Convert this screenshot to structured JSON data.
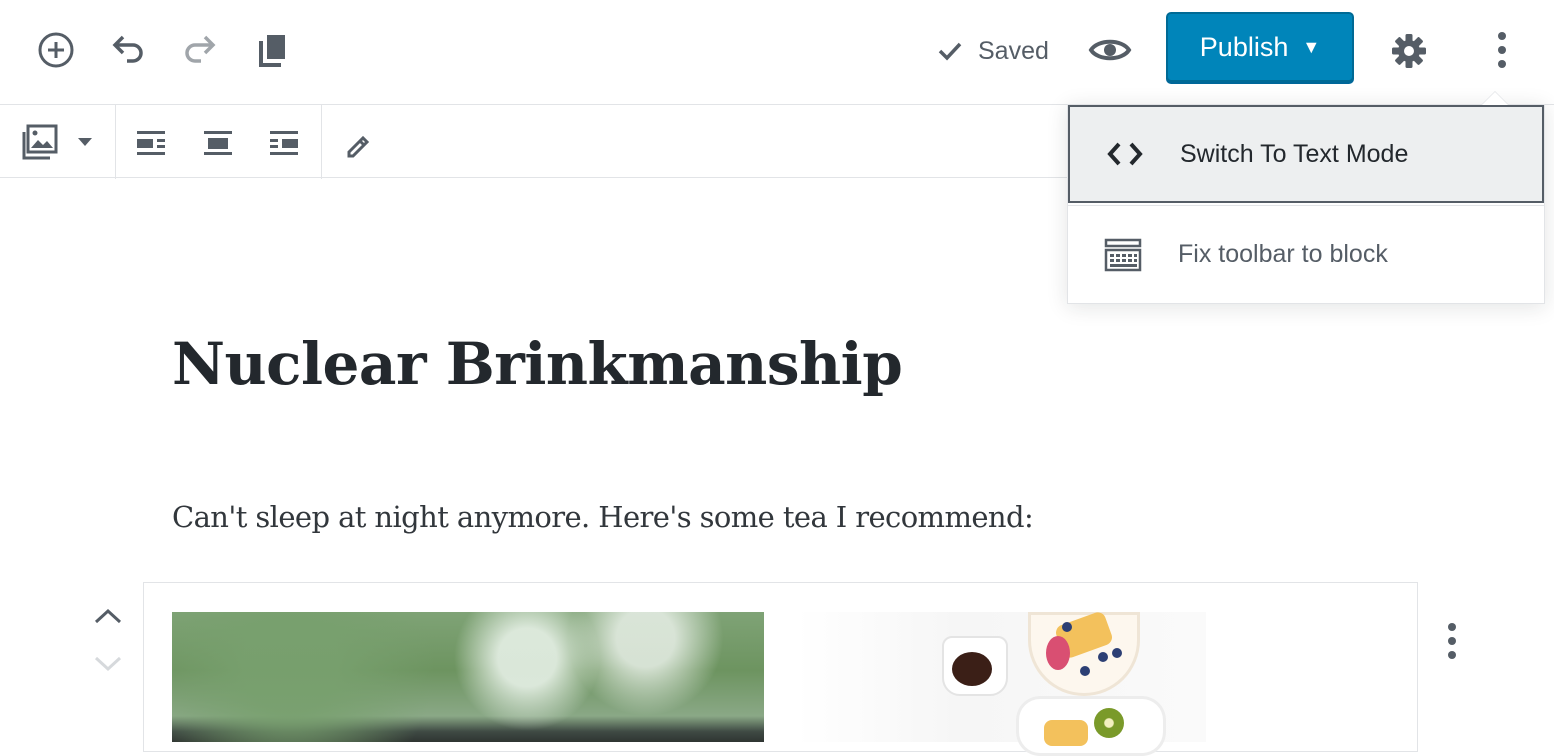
{
  "header": {
    "saved_label": "Saved",
    "publish_label": "Publish"
  },
  "menu": {
    "items": [
      {
        "label": "Switch To Text Mode",
        "icon": "code-icon"
      },
      {
        "label": "Fix toolbar to block",
        "icon": "keyboard-icon"
      }
    ]
  },
  "post": {
    "title": "Nuclear Brinkmanship",
    "paragraph": "Can't sleep at night anymore. Here's some tea I recommend:"
  },
  "icons": {
    "add": "add-block-icon",
    "undo": "undo-icon",
    "redo": "redo-icon",
    "copy": "copy-icon",
    "check": "check-icon",
    "preview": "eye-icon",
    "settings": "gear-icon",
    "more": "more-vertical-icon"
  },
  "colors": {
    "primary": "#0085ba",
    "primary_border": "#006a95",
    "text": "#32373c",
    "muted": "#555d66",
    "border": "#e2e4e7"
  }
}
